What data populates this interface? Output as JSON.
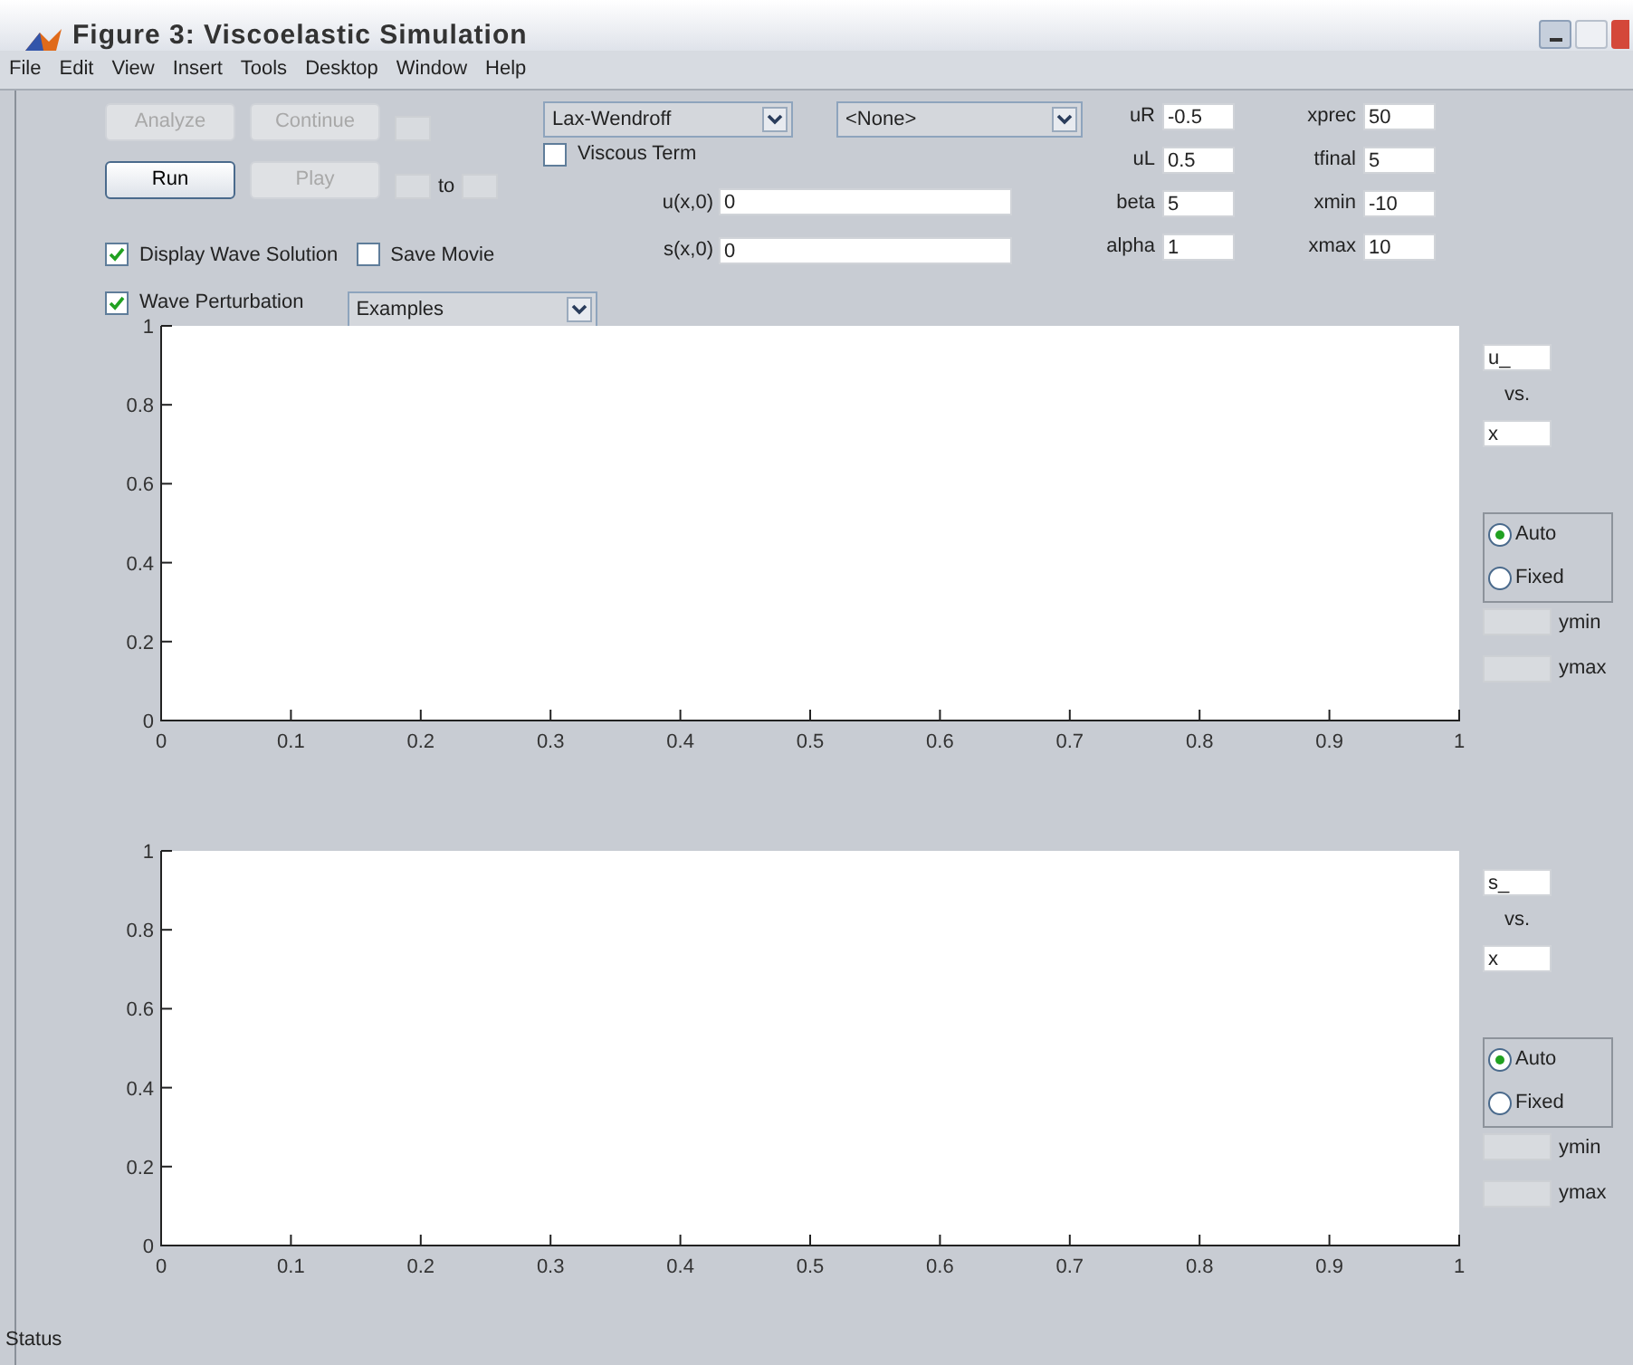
{
  "window": {
    "title": "Figure 3: Viscoelastic Simulation"
  },
  "menu": [
    "File",
    "Edit",
    "View",
    "Insert",
    "Tools",
    "Desktop",
    "Window",
    "Help"
  ],
  "buttons_row1": [
    {
      "label": "Analyze",
      "disabled": true
    },
    {
      "label": "Continue",
      "disabled": true
    }
  ],
  "buttons_row2": [
    {
      "label": "Run",
      "disabled": false
    },
    {
      "label": "Play",
      "disabled": true
    }
  ],
  "range_to": "to",
  "checks_row1": [
    {
      "label": "Display Wave Solution",
      "checked": true
    },
    {
      "label": "Save Movie",
      "checked": false
    }
  ],
  "wave_perturbation": {
    "label": "Wave Perturbation",
    "checked": true
  },
  "examples_dropdown": "Examples",
  "scheme_dropdown": "Lax-Wendroff",
  "none_dropdown": "<None>",
  "viscous_term": {
    "label": "Viscous Term",
    "checked": false
  },
  "initial_fields": [
    {
      "label": "u(x,0)",
      "value": "0"
    },
    {
      "label": "s(x,0)",
      "value": "0"
    }
  ],
  "params_col1": [
    {
      "label": "uR",
      "value": "-0.5"
    },
    {
      "label": "uL",
      "value": "0.5"
    },
    {
      "label": "beta",
      "value": "5"
    },
    {
      "label": "alpha",
      "value": "1"
    }
  ],
  "params_col2": [
    {
      "label": "xprec",
      "value": "50"
    },
    {
      "label": "tfinal",
      "value": "5"
    },
    {
      "label": "xmin",
      "value": "-10"
    },
    {
      "label": "xmax",
      "value": "10"
    }
  ],
  "plots": [
    {
      "xticks": [
        "0",
        "0.1",
        "0.2",
        "0.3",
        "0.4",
        "0.5",
        "0.6",
        "0.7",
        "0.8",
        "0.9",
        "1"
      ],
      "yticks": [
        "1",
        "0.8",
        "0.6",
        "0.4",
        "0.2",
        "0"
      ],
      "y_field": "u_",
      "vs": "vs.",
      "x_field": "x",
      "modes": [
        {
          "label": "Auto",
          "selected": true
        },
        {
          "label": "Fixed",
          "selected": false
        }
      ],
      "ymin": "ymin",
      "ymax": "ymax"
    },
    {
      "xticks": [
        "0",
        "0.1",
        "0.2",
        "0.3",
        "0.4",
        "0.5",
        "0.6",
        "0.7",
        "0.8",
        "0.9",
        "1"
      ],
      "yticks": [
        "1",
        "0.8",
        "0.6",
        "0.4",
        "0.2",
        "0"
      ],
      "y_field": "s_",
      "vs": "vs.",
      "x_field": "x",
      "modes": [
        {
          "label": "Auto",
          "selected": true
        },
        {
          "label": "Fixed",
          "selected": false
        }
      ],
      "ymin": "ymin",
      "ymax": "ymax"
    }
  ],
  "status": "Status"
}
